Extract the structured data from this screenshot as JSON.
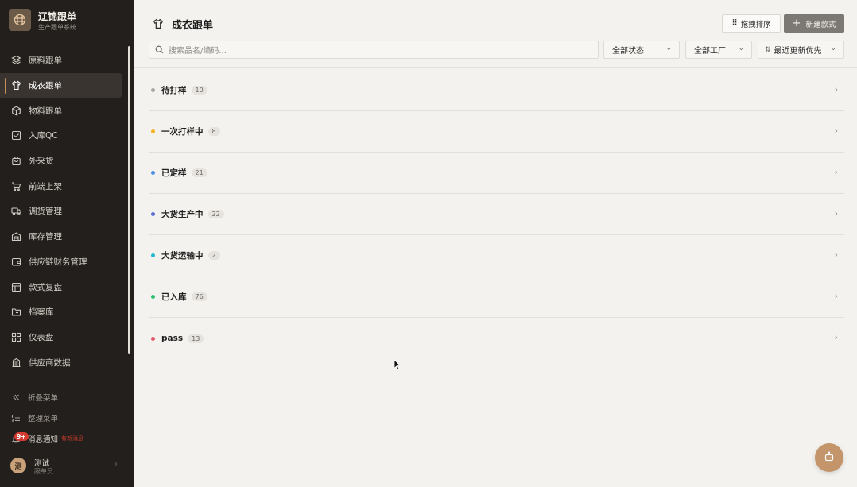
{
  "brand": {
    "title": "辽锦跟单",
    "subtitle": "生产跟单系统"
  },
  "nav": [
    {
      "label": "原料跟单",
      "icon": "layers-icon",
      "active": false
    },
    {
      "label": "成衣跟单",
      "icon": "shirt-icon",
      "active": true
    },
    {
      "label": "物料跟单",
      "icon": "box-icon",
      "active": false
    },
    {
      "label": "入库QC",
      "icon": "check-square-icon",
      "active": false
    },
    {
      "label": "外采货",
      "icon": "shopping-bag-icon",
      "active": false
    },
    {
      "label": "前端上架",
      "icon": "cart-icon",
      "active": false
    },
    {
      "label": "调货管理",
      "icon": "truck-icon",
      "active": false
    },
    {
      "label": "库存管理",
      "icon": "warehouse-icon",
      "active": false
    },
    {
      "label": "供应链财务管理",
      "icon": "wallet-icon",
      "active": false
    },
    {
      "label": "款式复盘",
      "icon": "table-icon",
      "active": false
    },
    {
      "label": "档案库",
      "icon": "folder-icon",
      "active": false
    },
    {
      "label": "仪表盘",
      "icon": "dashboard-icon",
      "active": false
    },
    {
      "label": "供应商数据",
      "icon": "building-icon",
      "active": false
    }
  ],
  "sidebar_bottom": {
    "collapse_label": "折叠菜单",
    "organize_label": "整理菜单",
    "notifications_label": "消息通知",
    "notifications_hint": "有新消息",
    "notifications_badge": "9+"
  },
  "user": {
    "avatar": "测",
    "name": "测试",
    "role": "跟单员"
  },
  "header": {
    "title": "成衣跟单",
    "sort_button": "拖拽排序",
    "new_button": "新建款式"
  },
  "search": {
    "placeholder": "搜索品名/编码..."
  },
  "filters": {
    "status": "全部状态",
    "factory": "全部工厂",
    "sort": "最近更新优先"
  },
  "groups": [
    {
      "label": "待打样",
      "count": "10",
      "color": "#a9a6a1"
    },
    {
      "label": "一次打样中",
      "count": "8",
      "color": "#f0b323"
    },
    {
      "label": "已定样",
      "count": "21",
      "color": "#4a90e2"
    },
    {
      "label": "大货生产中",
      "count": "22",
      "color": "#5b6fd6"
    },
    {
      "label": "大货运输中",
      "count": "2",
      "color": "#22b8cf"
    },
    {
      "label": "已入库",
      "count": "76",
      "color": "#2fbf71"
    },
    {
      "label": "pass",
      "count": "13",
      "color": "#e05a6a"
    }
  ],
  "colors": {
    "sidebar_bg": "#231f1c",
    "accent": "#c98f58",
    "page_bg": "#f3f2ee"
  }
}
